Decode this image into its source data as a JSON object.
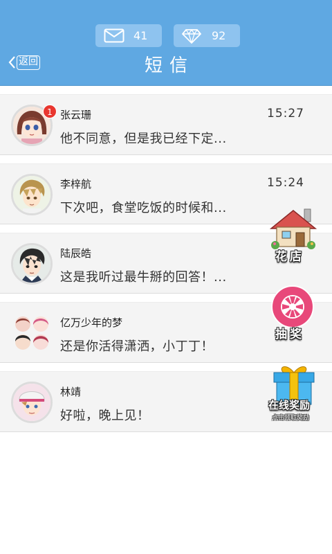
{
  "header": {
    "title": "短信",
    "back_label": "返回",
    "mail_count": "41",
    "gem_count": "92",
    "accent": "#5fa8e2"
  },
  "messages": [
    {
      "name": "张云珊",
      "time": "15:27",
      "preview": "他不同意，但是我已经下定...",
      "unread": "1"
    },
    {
      "name": "李梓航",
      "time": "15:24",
      "preview": "下次吧，食堂吃饭的时候和..."
    },
    {
      "name": "陆辰皓",
      "time": "",
      "preview": "这是我听过最牛掰的回答！..."
    },
    {
      "name": "亿万少年的梦",
      "time": "",
      "preview": "还是你活得潇洒，小丁丁！"
    },
    {
      "name": "林靖",
      "time": "",
      "preview": "好啦，晚上见！"
    }
  ],
  "floating": {
    "flower_shop": "花店",
    "lottery": "抽奖",
    "online_reward": "在线奖励",
    "online_reward_sub": "点击领取奖励"
  },
  "icons": {
    "mail": "envelope-icon",
    "gem": "diamond-icon",
    "back": "chevron-left-icon"
  }
}
